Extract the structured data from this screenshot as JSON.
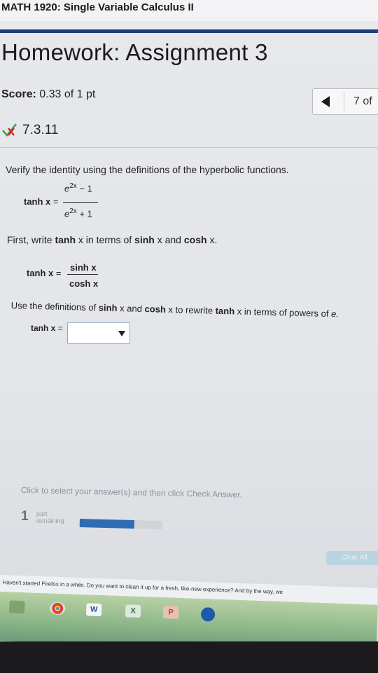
{
  "course": {
    "title": "MATH 1920: Single Variable Calculus II"
  },
  "assignment": {
    "title": "Homework: Assignment 3",
    "score_label": "Score:",
    "score_value": "0.33 of 1 pt",
    "nav_count": "7 of"
  },
  "question": {
    "number": "7.3.11",
    "status_icon": "partial-credit-icon",
    "instruction": "Verify the identity using the definitions of the hyperbolic functions.",
    "identity": {
      "lhs": "tanh x",
      "eq": "=",
      "num_base": "e",
      "num_exp": "2x",
      "num_tail": "− 1",
      "den_base": "e",
      "den_exp": "2x",
      "den_tail": "+ 1"
    },
    "step1": {
      "pre": "First, write",
      "fn": "tanh",
      "mid1": "x in terms of",
      "fn2": "sinh",
      "mid2": "x and",
      "fn3": "cosh",
      "post": "x."
    },
    "step1_eq": {
      "lhs": "tanh x",
      "eq": "=",
      "num": "sinh x",
      "den": "cosh x"
    },
    "step2": {
      "pre": "Use the definitions of",
      "fn1": "sinh",
      "mid1": "x and",
      "fn2": "cosh",
      "mid2": "x to rewrite",
      "fn3": "tanh",
      "post": "x in terms of powers of",
      "var": "e."
    },
    "answer": {
      "lhs": "tanh x",
      "eq": "=",
      "selected": ""
    }
  },
  "footer": {
    "hint": "Click to select your answer(s) and then click Check Answer.",
    "parts_count": "1",
    "parts_label_1": "part",
    "parts_label_2": "remaining",
    "progress": 0.66,
    "clear_label": "Clear All"
  },
  "browser": {
    "notification": "Haven't started Firefox in a while. Do you want to clean it up for a fresh, like-new experience? And by the way, we"
  },
  "taskbar": {
    "icons": [
      {
        "name": "chrome-icon",
        "label": ""
      },
      {
        "name": "word-icon",
        "label": "W"
      },
      {
        "name": "excel-icon",
        "label": "X"
      },
      {
        "name": "powerpoint-icon",
        "label": "P"
      },
      {
        "name": "firefox-icon",
        "label": ""
      }
    ]
  },
  "colors": {
    "accent": "#1c3f7a",
    "progress": "#2e6db4",
    "input_border": "#8aa7cf"
  }
}
